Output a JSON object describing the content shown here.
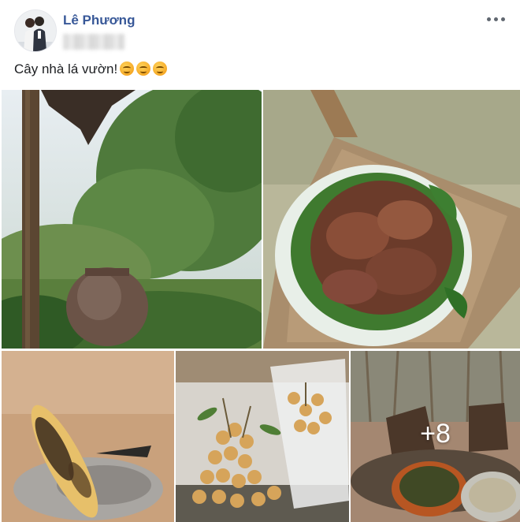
{
  "post": {
    "author_name": "Lê Phương",
    "caption": "Cây nhà lá vườn!",
    "caption_emojis": [
      "smiling-face-icon",
      "smiling-face-icon",
      "smiling-face-icon"
    ],
    "more_options_icon": "ellipsis-icon",
    "photos": [
      {
        "subject": "garden with clay jar"
      },
      {
        "subject": "grilled meat on leaves on wooden chair"
      },
      {
        "subject": "roasted corn on embers"
      },
      {
        "subject": "longan fruit bunches"
      },
      {
        "subject": "outdoor table with food",
        "more_count": "+8"
      }
    ]
  },
  "colors": {
    "author_link": "#385898",
    "text": "#1c1e21",
    "icon_gray": "#606770"
  }
}
